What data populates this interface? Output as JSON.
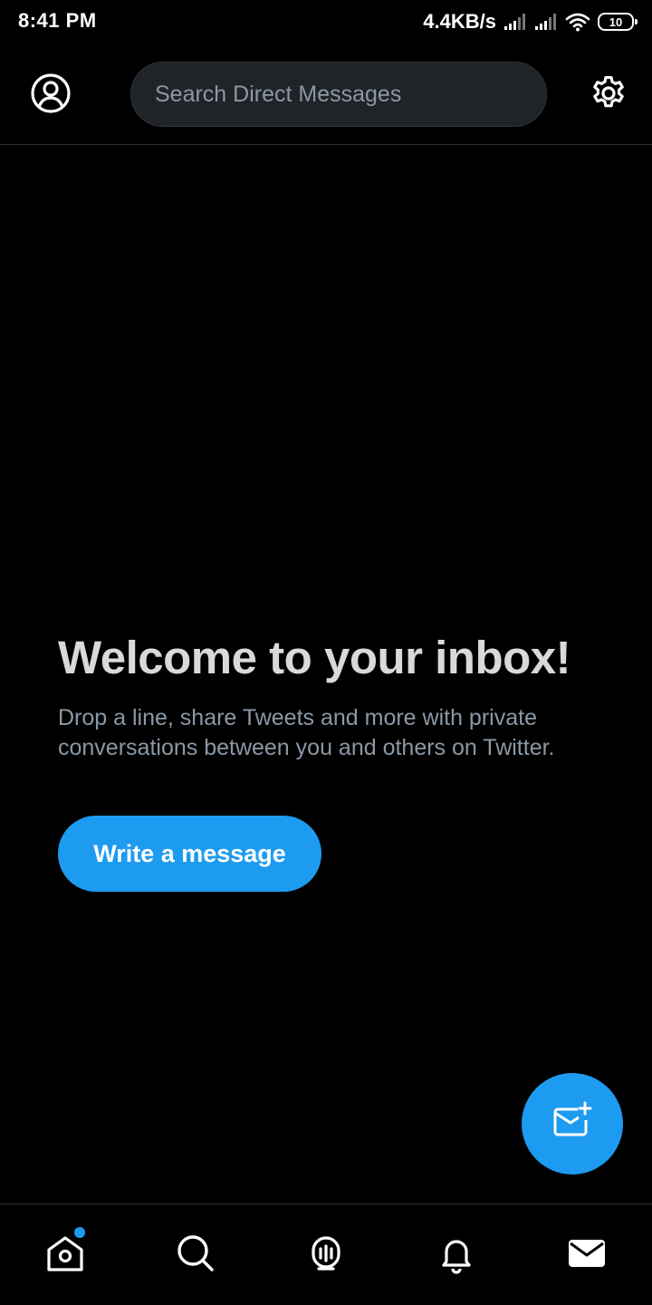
{
  "status_bar": {
    "time": "8:41 PM",
    "net_speed": "4.4KB/s",
    "battery": "10"
  },
  "header": {
    "search_placeholder": "Search Direct Messages",
    "profile_icon": "profile-icon",
    "settings_icon": "gear-icon"
  },
  "welcome": {
    "title": "Welcome to your inbox!",
    "description": "Drop a line, share Tweets and more with private conversations between you and others on Twitter.",
    "button_label": "Write a message"
  },
  "fab": {
    "icon": "new-message-icon"
  },
  "bottom_nav": {
    "items": [
      {
        "icon": "home-icon",
        "badge": true
      },
      {
        "icon": "search-icon"
      },
      {
        "icon": "spaces-icon"
      },
      {
        "icon": "bell-icon"
      },
      {
        "icon": "mail-icon",
        "active": true
      }
    ]
  },
  "colors": {
    "accent": "#1d9bf0",
    "background": "#000000",
    "secondary_text": "#8b98a5",
    "divider": "#2f3336"
  }
}
